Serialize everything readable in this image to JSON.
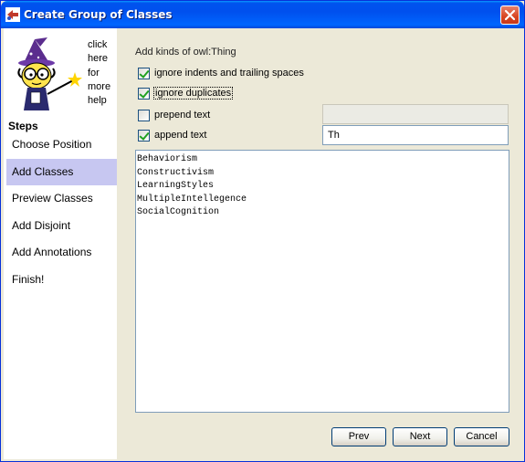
{
  "window": {
    "title": "Create Group of Classes"
  },
  "help": {
    "text": "click here for more help"
  },
  "steps": {
    "title": "Steps",
    "items": [
      {
        "label": "Choose Position",
        "active": false
      },
      {
        "label": "Add Classes",
        "active": true
      },
      {
        "label": "Preview Classes",
        "active": false
      },
      {
        "label": "Add Disjoint",
        "active": false
      },
      {
        "label": "Add Annotations",
        "active": false
      },
      {
        "label": "Finish!",
        "active": false
      }
    ]
  },
  "main": {
    "heading": "Add kinds of owl:Thing",
    "options": {
      "ignore_indents": {
        "label": "ignore indents and trailing spaces",
        "checked": true
      },
      "ignore_duplicates": {
        "label": "ignore duplicates",
        "checked": true
      },
      "prepend_text": {
        "label": "prepend text",
        "checked": false,
        "value": ""
      },
      "append_text": {
        "label": "append text",
        "checked": true,
        "value": "Th"
      }
    },
    "classes_text": [
      "Behaviorism",
      "Constructivism",
      "LearningStyles",
      "MultipleIntellegence",
      "SocialCognition"
    ]
  },
  "buttons": {
    "prev": "Prev",
    "next": "Next",
    "cancel": "Cancel"
  },
  "colors": {
    "titlebar": "#0053ee",
    "active_step": "#c7c7f1",
    "checkmark": "#21a121",
    "close_button": "#d8441f"
  }
}
